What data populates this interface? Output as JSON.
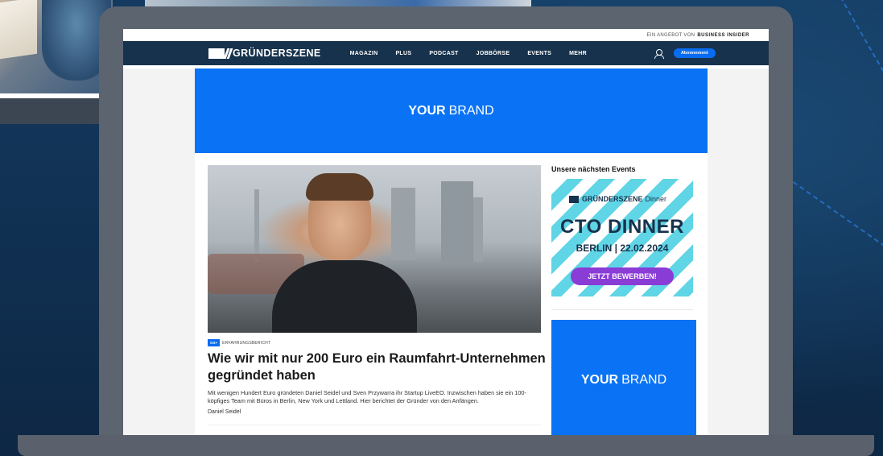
{
  "topbar": {
    "offer_prefix": "EIN ANGEBOT VON",
    "offer_brand": "BUSINESS INSIDER"
  },
  "nav": {
    "logo": "GRÜNDERSZENE",
    "items": [
      "MAGAZIN",
      "PLUS",
      "PODCAST",
      "JOBBÖRSE",
      "EVENTS",
      "MEHR"
    ],
    "subscribe_label": "Abonnement"
  },
  "ads": {
    "top_banner": {
      "bold": "YOUR",
      "rest": "BRAND"
    },
    "sidebar_banner": {
      "bold": "YOUR",
      "rest": "BRAND"
    }
  },
  "article": {
    "badge": "GS+",
    "category": "ERFAHRUNGSBERICHT",
    "headline": "Wie wir mit nur 200 Euro ein Raumfahrt-Unternehmen gegründet haben",
    "teaser": "Mit wenigen Hundert Euro gründeten Daniel Seidel und Sven Przywarra ihr Startup LiveEO. Inzwischen haben sie ein 100-köpfiges Team mit Büros in Berlin, New York und Lettland. Hier berichtet der Gründer von den Anfängen.",
    "author": "Daniel Seidel"
  },
  "sidebar": {
    "events_title": "Unsere nächsten Events",
    "event": {
      "logo_text": "GRÜNDERSZENE",
      "logo_suffix": "Dinner",
      "title": "CTO DINNER",
      "date": "BERLIN | 22.02.2024",
      "cta": "JETZT BEWERBEN!"
    }
  },
  "colors": {
    "navbar": "#17324c",
    "accent": "#0a6cf0",
    "ad_blue": "#0a73f5",
    "cta_purple": "#8a3cd6"
  }
}
